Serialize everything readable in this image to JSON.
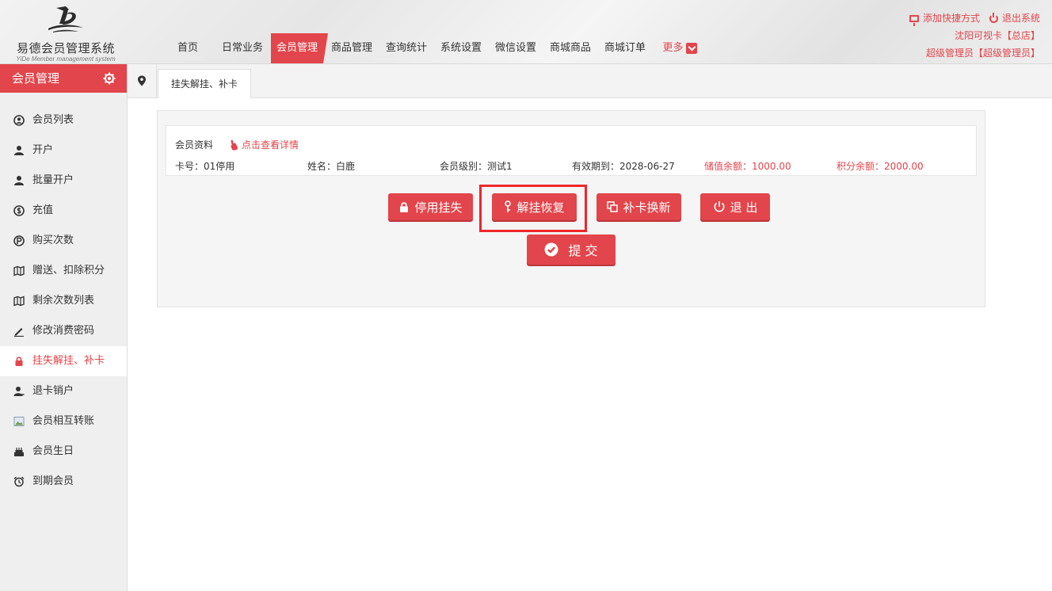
{
  "header": {
    "logo_title": "易德会员管理系统",
    "logo_subtitle": "YiDe Member management system",
    "nav": [
      {
        "label": "首页",
        "active": false
      },
      {
        "label": "日常业务",
        "active": false
      },
      {
        "label": "会员管理",
        "active": true
      },
      {
        "label": "商品管理",
        "active": false
      },
      {
        "label": "查询统计",
        "active": false
      },
      {
        "label": "系统设置",
        "active": false
      },
      {
        "label": "微信设置",
        "active": false
      },
      {
        "label": "商城商品",
        "active": false
      },
      {
        "label": "商城订单",
        "active": false
      }
    ],
    "more_label": "更多",
    "add_shortcut": "添加快捷方式",
    "logout": "退出系统",
    "store": "沈阳可视卡【总店】",
    "user": "超级管理员【超级管理员】"
  },
  "sidebar": {
    "title": "会员管理",
    "items": [
      {
        "label": "会员列表",
        "icon": "user-circle-icon"
      },
      {
        "label": "开户",
        "icon": "user-icon"
      },
      {
        "label": "批量开户",
        "icon": "user-icon"
      },
      {
        "label": "充值",
        "icon": "coin-icon"
      },
      {
        "label": "购买次数",
        "icon": "p-coin-icon"
      },
      {
        "label": "赠送、扣除积分",
        "icon": "map-icon"
      },
      {
        "label": "剩余次数列表",
        "icon": "map-icon"
      },
      {
        "label": "修改消费密码",
        "icon": "pencil-icon"
      },
      {
        "label": "挂失解挂、补卡",
        "icon": "lock-icon"
      },
      {
        "label": "退卡销户",
        "icon": "user-remove-icon"
      },
      {
        "label": "会员相互转账",
        "icon": "image-icon"
      },
      {
        "label": "会员生日",
        "icon": "cake-icon"
      },
      {
        "label": "到期会员",
        "icon": "alarm-icon"
      }
    ]
  },
  "tab": {
    "label": "挂失解挂、补卡"
  },
  "member": {
    "section_title": "会员资料",
    "detail_link": "点击查看详情",
    "card_no": "卡号：01停用",
    "name": "姓名：白鹿",
    "level": "会员级别：测试1",
    "expiry": "有效期到：2028-06-27",
    "balance": "储值余额：1000.00",
    "points": "积分余额：2000.00"
  },
  "actions": {
    "suspend": "停用挂失",
    "restore": "解挂恢复",
    "reissue": "补卡换新",
    "exit": "退 出",
    "submit": "提 交"
  },
  "colors": {
    "accent": "#e2454b",
    "highlight": "#f0262c"
  }
}
